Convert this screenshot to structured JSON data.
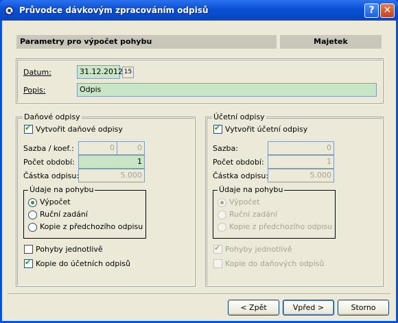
{
  "window": {
    "title": "Průvodce dávkovým zpracováním odpisů",
    "help_glyph": "?",
    "close_glyph": "✕"
  },
  "header": {
    "left": "Parametry pro výpočet pohybu",
    "right": "Majetek"
  },
  "top": {
    "datum_label": "Datum:",
    "datum_value": "31.12.2012",
    "cal_glyph": "15",
    "popis_label": "Popis:",
    "popis_value": "Odpis"
  },
  "danove": {
    "title": "Daňové odpisy",
    "create_label": "Vytvořit daňové odpisy",
    "sazba_label": "Sazba / koef.:",
    "sazba1": "0",
    "sazba2": "0",
    "pocet_label": "Počet období:",
    "pocet_value": "1",
    "castka_label": "Částka odpisu:",
    "castka_value": "5.000",
    "udaje_title": "Údaje na pohybu",
    "radio1": "Výpočet",
    "radio2": "Ruční zadání",
    "radio3": "Kopie z předchozího odpisu",
    "pohyby_label": "Pohyby jednotlivě",
    "kopie_label": "Kopie do účetních odpisů"
  },
  "ucetni": {
    "title": "Účetní odpisy",
    "create_label": "Vytvořit účetní odpisy",
    "sazba_label": "Sazba:",
    "sazba_value": "0",
    "pocet_label": "Počet období:",
    "pocet_value": "1",
    "castka_label": "Částka odpisu:",
    "castka_value": "5.000",
    "udaje_title": "Údaje na pohybu",
    "radio1": "Výpočet",
    "radio2": "Ruční zadání",
    "radio3": "Kopie z předchozího odpisu",
    "pohyby_label": "Pohyby jednotlivě",
    "kopie_label": "Kopie do daňových odpisů"
  },
  "buttons": {
    "back": "< Zpět",
    "next": "Vpřed >",
    "cancel": "Storno"
  },
  "checkmark": "✔"
}
